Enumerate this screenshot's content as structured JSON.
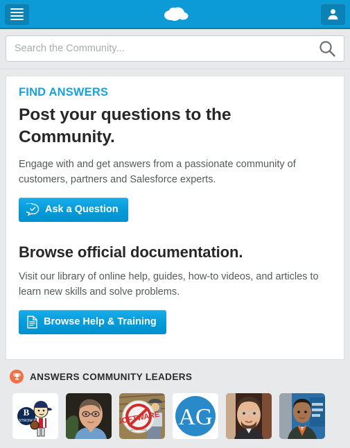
{
  "header": {
    "menu_button_label": "Menu",
    "menu_icon": "hamburger-icon",
    "logo_icon": "salesforce-cloud-logo",
    "logo_label": "Salesforce",
    "account_icon": "user-avatar-icon",
    "account_button_label": "Account",
    "background_color": "#0d9bd8",
    "border_color": "#0b7fb0"
  },
  "search": {
    "placeholder": "Search the Community...",
    "value": "",
    "icon": "magnifier-icon"
  },
  "main": {
    "eyebrow": "FIND ANSWERS",
    "eyebrow_color": "#14a3e0",
    "headline": "Post your questions to the Community.",
    "blurb": "Engage with and get answers from a passionate community of customers, partners and Salesforce experts.",
    "primary_button": {
      "label": "Ask a Question",
      "icon": "chat-bubble-check-icon",
      "color": "#039ad9"
    },
    "subhead": "Browse official documentation.",
    "sub_blurb": "Visit our library of online help, guides, how-to videos, and articles to learn new skills and solve problems.",
    "secondary_button": {
      "label": "Browse Help & Training",
      "icon": "document-page-icon",
      "color": "#039ad9"
    }
  },
  "leaders": {
    "title": "ANSWERS COMMUNITY LEADERS",
    "badge_icon": "trophy-icon",
    "badge_color": "#ef7246",
    "avatars": [
      {
        "name": "avatar-1",
        "alt": "Charlie Brown Boston B Strong cartoon"
      },
      {
        "name": "avatar-2",
        "alt": "Man with glasses in blue shirt"
      },
      {
        "name": "avatar-3",
        "alt": "No Software red circle sign"
      },
      {
        "name": "avatar-4",
        "alt": "AG blue circle monogram"
      },
      {
        "name": "avatar-5",
        "alt": "Man with glasses and beard"
      },
      {
        "name": "avatar-6",
        "alt": "Man with lanyard outdoors"
      }
    ]
  }
}
